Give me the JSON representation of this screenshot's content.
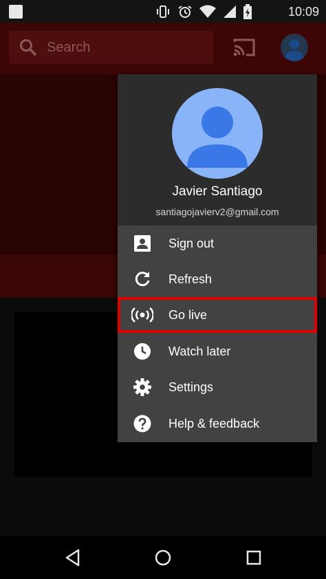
{
  "status_bar": {
    "time": "10:09",
    "icons": [
      "notification-square-icon",
      "vibrate-icon",
      "alarm-icon",
      "wifi-icon",
      "cell-signal-icon",
      "battery-charging-icon"
    ]
  },
  "app_bar": {
    "search_placeholder": "Search",
    "icons": [
      "search-icon",
      "cast-icon",
      "account-avatar-icon"
    ],
    "color": "#3d0606"
  },
  "account_menu": {
    "user_name": "Javier Santiago",
    "user_email": "santiagojavierv2@gmail.com",
    "highlight_color": "#e00000",
    "items": [
      {
        "label": "Sign out",
        "icon": "account-box-icon"
      },
      {
        "label": "Refresh",
        "icon": "refresh-icon"
      },
      {
        "label": "Go live",
        "icon": "live-broadcast-icon",
        "highlighted": true
      },
      {
        "label": "Watch later",
        "icon": "clock-icon"
      },
      {
        "label": "Settings",
        "icon": "gear-icon"
      },
      {
        "label": "Help & feedback",
        "icon": "help-icon"
      }
    ]
  },
  "nav_bar": {
    "buttons": [
      "back-icon",
      "home-icon",
      "recents-icon"
    ]
  }
}
